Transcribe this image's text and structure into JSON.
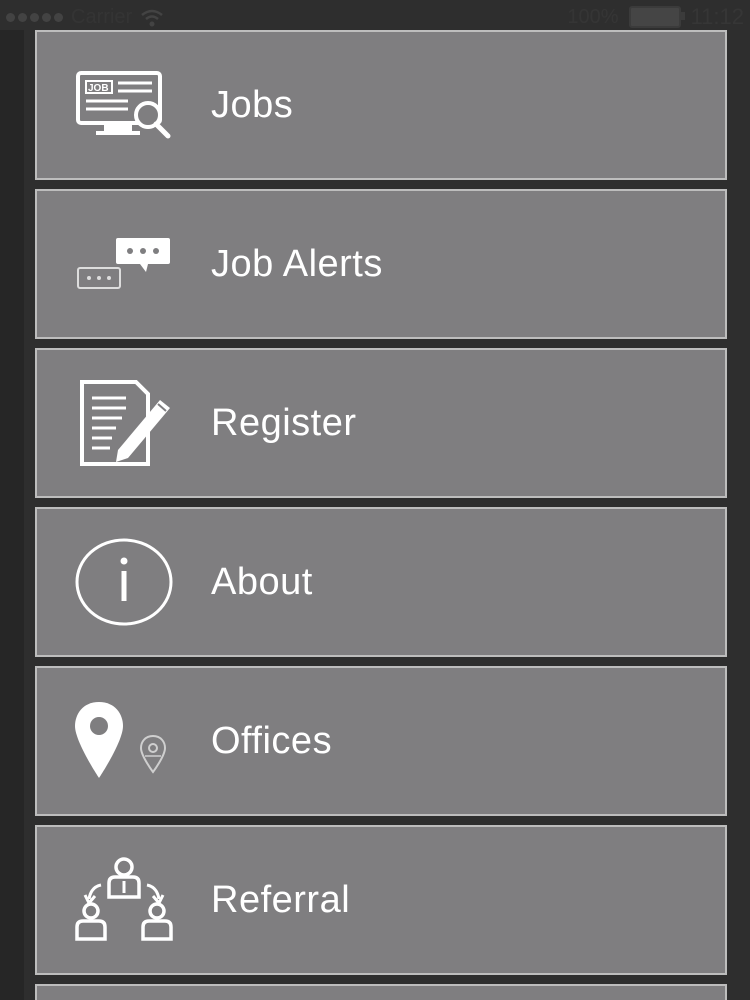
{
  "status_bar": {
    "carrier": "Carrier",
    "battery": "100%",
    "time": "11:12"
  },
  "menu": {
    "items": [
      {
        "label": "Jobs",
        "icon": "job-search-icon"
      },
      {
        "label": "Job Alerts",
        "icon": "chat-bubbles-icon"
      },
      {
        "label": "Register",
        "icon": "form-pencil-icon"
      },
      {
        "label": "About",
        "icon": "info-icon"
      },
      {
        "label": "Offices",
        "icon": "map-pin-icon"
      },
      {
        "label": "Referral",
        "icon": "people-referral-icon"
      }
    ]
  },
  "colors": {
    "background": "#2e2e2e",
    "tile": "#7f7e80",
    "tile_border": "#bdbdbd",
    "text": "#ffffff"
  }
}
